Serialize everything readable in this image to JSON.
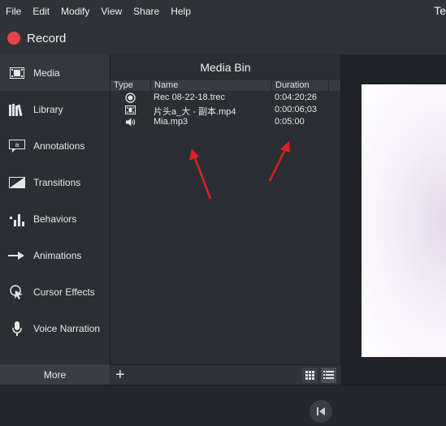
{
  "menu": {
    "items": [
      "File",
      "Edit",
      "Modify",
      "View",
      "Share",
      "Help"
    ],
    "app_title": "Te"
  },
  "record": {
    "label": "Record"
  },
  "sidebar": {
    "items": [
      {
        "label": "Media",
        "icon": "media-filmstrip-icon",
        "active": true
      },
      {
        "label": "Library",
        "icon": "library-books-icon"
      },
      {
        "label": "Annotations",
        "icon": "annotation-callout-icon"
      },
      {
        "label": "Transitions",
        "icon": "transition-icon"
      },
      {
        "label": "Behaviors",
        "icon": "behaviors-icon"
      },
      {
        "label": "Animations",
        "icon": "animation-arrow-icon"
      },
      {
        "label": "Cursor Effects",
        "icon": "cursor-effects-icon"
      },
      {
        "label": "Voice Narration",
        "icon": "microphone-icon"
      }
    ],
    "more_label": "More"
  },
  "media_bin": {
    "title": "Media Bin",
    "columns": {
      "type": "Type",
      "name": "Name",
      "duration": "Duration"
    },
    "rows": [
      {
        "type_icon": "record-icon",
        "name": "Rec 08-22-18.trec",
        "duration": "0:04:20;26"
      },
      {
        "type_icon": "video-icon",
        "name": "片头a_大 - 副本.mp4",
        "duration": "0:00:06;03"
      },
      {
        "type_icon": "audio-icon",
        "name": "Mia.mp3",
        "duration": "0:05:00"
      }
    ]
  },
  "colors": {
    "record_red": "#e8424f",
    "annotation_arrow": "#e02020",
    "panel_bg": "#2b2e33"
  }
}
